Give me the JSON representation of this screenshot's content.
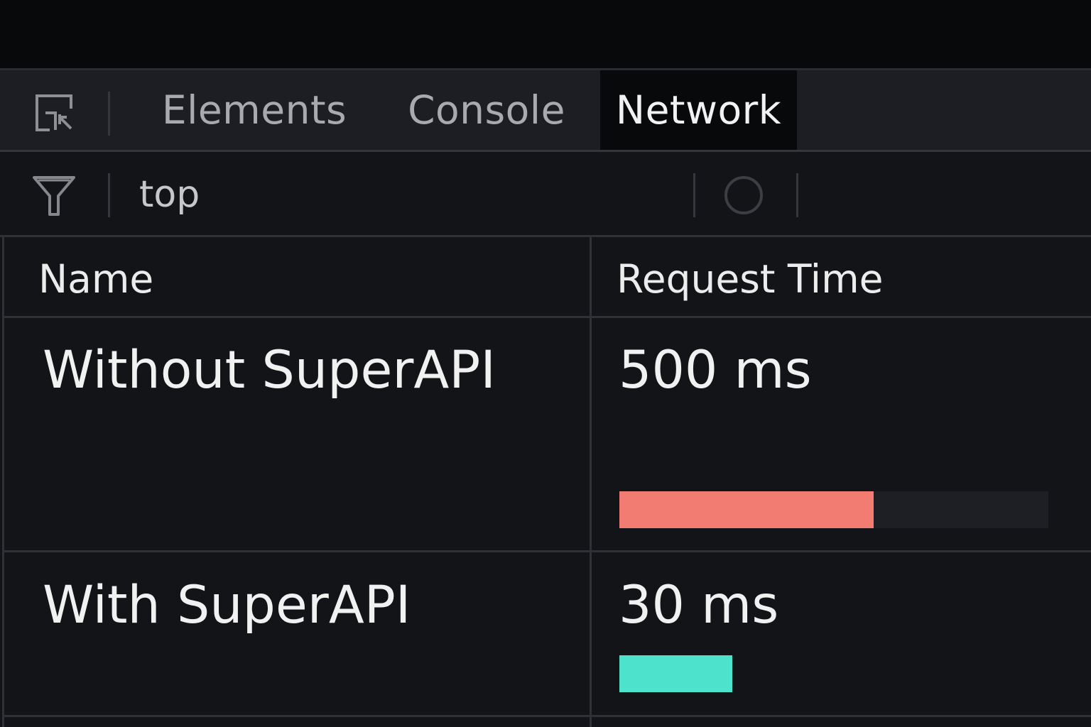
{
  "tabs": {
    "elements": "Elements",
    "console": "Console",
    "network": "Network",
    "active": "network"
  },
  "toolbar": {
    "context": "top"
  },
  "table": {
    "columns": {
      "name": "Name",
      "time": "Request Time"
    },
    "rows": [
      {
        "name": "Without SuperAPI",
        "time_label": "500 ms",
        "time_ms": 500,
        "bar_color": "#f27c72"
      },
      {
        "name": "With SuperAPI",
        "time_label": "30 ms",
        "time_ms": 30,
        "bar_color": "#4ce2cc"
      }
    ]
  },
  "colors": {
    "background": "#131418",
    "tabbar": "#1d1e23",
    "active_tab": "#08090b",
    "slow_bar": "#f27c72",
    "fast_bar": "#4ce2cc"
  }
}
